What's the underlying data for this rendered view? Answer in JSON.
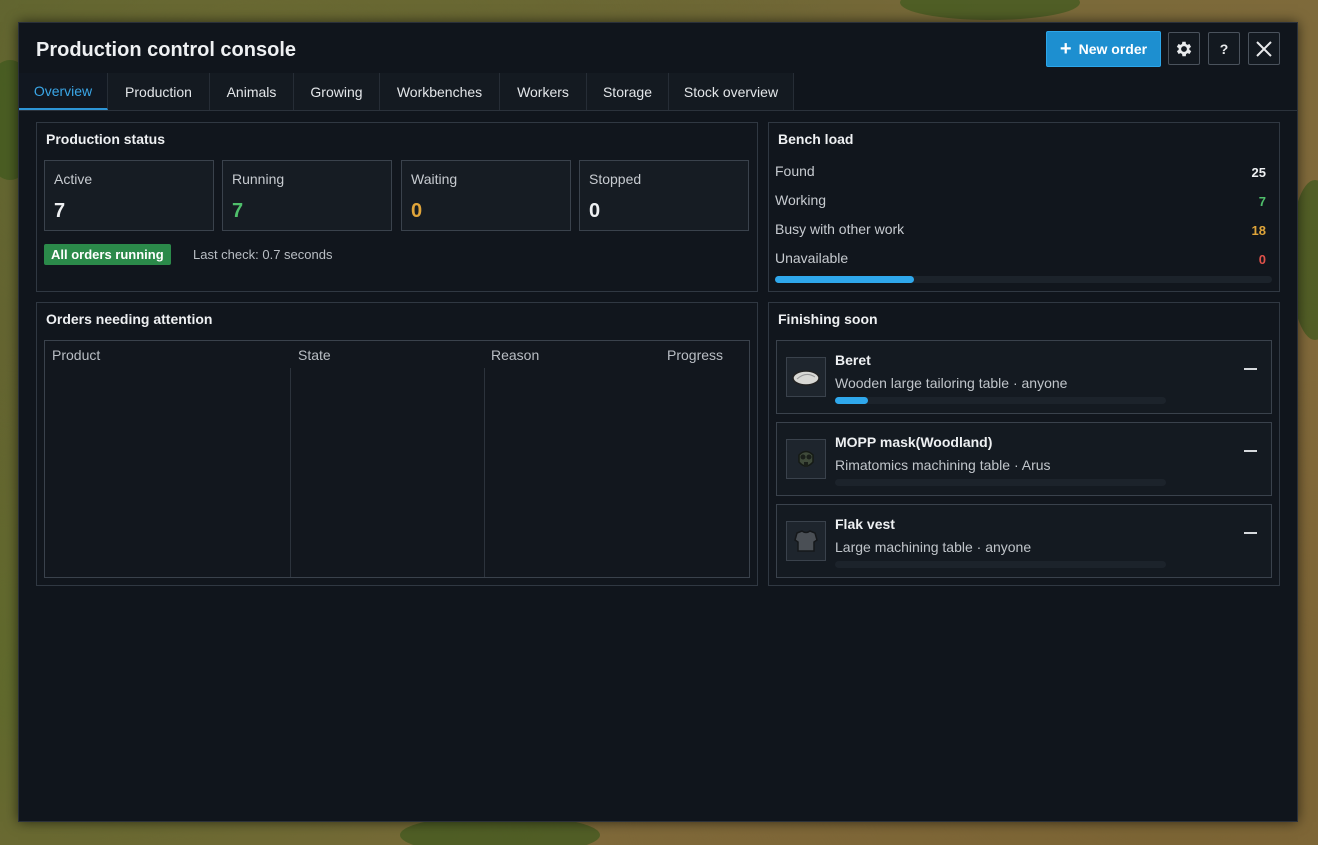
{
  "window": {
    "title": "Production control console",
    "new_order_label": "New order",
    "help_label": "?"
  },
  "tabs": [
    {
      "label": "Overview",
      "active": true
    },
    {
      "label": "Production"
    },
    {
      "label": "Animals"
    },
    {
      "label": "Growing"
    },
    {
      "label": "Workbenches"
    },
    {
      "label": "Workers"
    },
    {
      "label": "Storage"
    },
    {
      "label": "Stock overview"
    }
  ],
  "production_status": {
    "title": "Production status",
    "cards": [
      {
        "label": "Active",
        "value": "7",
        "color": "#eef0f2"
      },
      {
        "label": "Running",
        "value": "7",
        "color": "#4fbf6b"
      },
      {
        "label": "Waiting",
        "value": "0",
        "color": "#e0a53a"
      },
      {
        "label": "Stopped",
        "value": "0",
        "color": "#eef0f2"
      }
    ],
    "badge": "All orders running",
    "last_check": "Last check: 0.7 seconds"
  },
  "bench_load": {
    "title": "Bench load",
    "rows": [
      {
        "label": "Found",
        "value": "25",
        "color": "#eef0f2"
      },
      {
        "label": "Working",
        "value": "7",
        "color": "#4fbf6b"
      },
      {
        "label": "Busy with other work",
        "value": "18",
        "color": "#e0a53a"
      },
      {
        "label": "Unavailable",
        "value": "0",
        "color": "#e0524a"
      }
    ],
    "load_fraction": 0.28
  },
  "attention": {
    "title": "Orders needing attention",
    "columns": [
      "Product",
      "State",
      "Reason",
      "Progress"
    ]
  },
  "finishing": {
    "title": "Finishing soon",
    "items": [
      {
        "name": "Beret",
        "detail": "Wooden large tailoring table · anyone",
        "progress": 0.1,
        "icon": "beret-icon"
      },
      {
        "name": "MOPP mask(Woodland)",
        "detail": "Rimatomics machining table · Arus",
        "progress": 0.0,
        "icon": "gas-mask-icon"
      },
      {
        "name": "Flak vest",
        "detail": "Large machining table · anyone",
        "progress": 0.0,
        "icon": "vest-icon"
      }
    ]
  }
}
